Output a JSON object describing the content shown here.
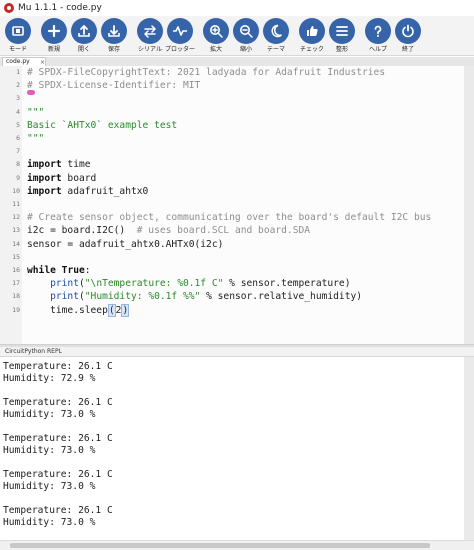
{
  "window": {
    "title": "Mu 1.1.1 - code.py"
  },
  "toolbar": [
    {
      "label": "モード",
      "icon": "mode-icon"
    },
    {
      "label": "新規",
      "icon": "plus-icon"
    },
    {
      "label": "開く",
      "icon": "upload-icon"
    },
    {
      "label": "保存",
      "icon": "download-icon"
    },
    {
      "label": "シリアル",
      "icon": "arrows-icon"
    },
    {
      "label": "プロッター",
      "icon": "pulse-icon"
    },
    {
      "label": "拡大",
      "icon": "zoom-in-icon"
    },
    {
      "label": "縮小",
      "icon": "zoom-out-icon"
    },
    {
      "label": "テーマ",
      "icon": "moon-icon"
    },
    {
      "label": "チェック",
      "icon": "thumbs-up-icon"
    },
    {
      "label": "整形",
      "icon": "list-icon"
    },
    {
      "label": "ヘルプ",
      "icon": "help-icon"
    },
    {
      "label": "終了",
      "icon": "power-icon"
    }
  ],
  "tab": {
    "name": "code.py",
    "close": "×"
  },
  "editor": {
    "line_numbers": [
      "1",
      "2",
      "3",
      "4",
      "5",
      "6",
      "7",
      "8",
      "9",
      "10",
      "11",
      "12",
      "13",
      "14",
      "15",
      "16",
      "17",
      "18",
      "19"
    ],
    "lines": [
      [
        {
          "t": "# SPDX-FileCopyrightText: 2021 ladyada for Adafruit Industries",
          "c": "comment"
        }
      ],
      [
        {
          "t": "# SPDX-License-Identifier: MIT",
          "c": "comment"
        }
      ],
      [],
      [
        {
          "t": "\"\"\"",
          "c": "str"
        }
      ],
      [
        {
          "t": "Basic `AHTx0` example test",
          "c": "str"
        }
      ],
      [
        {
          "t": "\"\"\"",
          "c": "str"
        }
      ],
      [],
      [
        {
          "t": "import",
          "c": "kw"
        },
        {
          "t": " time",
          "c": "normal"
        }
      ],
      [
        {
          "t": "import",
          "c": "kw"
        },
        {
          "t": " board",
          "c": "normal"
        }
      ],
      [
        {
          "t": "import",
          "c": "kw"
        },
        {
          "t": " adafruit_ahtx0",
          "c": "normal"
        }
      ],
      [],
      [
        {
          "t": "# Create sensor object, communicating over the board's default I2C bus",
          "c": "comment"
        }
      ],
      [
        {
          "t": "i2c = board.I2C()  ",
          "c": "normal"
        },
        {
          "t": "# uses board.SCL and board.SDA",
          "c": "comment"
        }
      ],
      [
        {
          "t": "sensor = adafruit_ahtx0.AHTx0(i2c)",
          "c": "normal"
        }
      ],
      [],
      [
        {
          "t": "while",
          "c": "kw"
        },
        {
          "t": " ",
          "c": "normal"
        },
        {
          "t": "True",
          "c": "kw"
        },
        {
          "t": ":",
          "c": "normal"
        }
      ],
      [
        {
          "t": "    ",
          "c": "normal"
        },
        {
          "t": "print",
          "c": "fn"
        },
        {
          "t": "(",
          "c": "normal"
        },
        {
          "t": "\"\\nTemperature: %0.1f C\"",
          "c": "str"
        },
        {
          "t": " % sensor.temperature)",
          "c": "normal"
        }
      ],
      [
        {
          "t": "    ",
          "c": "normal"
        },
        {
          "t": "print",
          "c": "fn"
        },
        {
          "t": "(",
          "c": "normal"
        },
        {
          "t": "\"Humidity: %0.1f %%\"",
          "c": "str"
        },
        {
          "t": " % sensor.relative_humidity)",
          "c": "normal"
        }
      ],
      [
        {
          "t": "    time.sleep",
          "c": "normal"
        },
        {
          "t": "(",
          "c": "paren"
        },
        {
          "t": "2",
          "c": "normal"
        },
        {
          "t": ")",
          "c": "paren"
        }
      ]
    ]
  },
  "repl": {
    "title": "CircuitPython REPL",
    "lines": [
      "Temperature: 26.1 C",
      "Humidity: 72.9 %",
      "",
      "Temperature: 26.1 C",
      "Humidity: 73.0 %",
      "",
      "Temperature: 26.1 C",
      "Humidity: 73.0 %",
      "",
      "Temperature: 26.1 C",
      "Humidity: 73.0 %",
      "",
      "Temperature: 26.1 C",
      "Humidity: 73.0 %"
    ]
  },
  "colors": {
    "toolbar_button": "#3565a8",
    "string": "#2a8a2a",
    "comment": "#8e8e8e",
    "builtin": "#1f4fa8"
  }
}
